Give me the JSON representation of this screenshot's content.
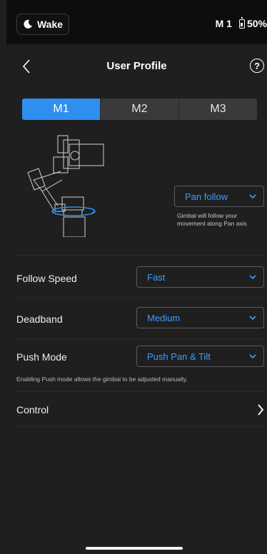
{
  "status_bar": {
    "wake_label": "Wake",
    "mode_label": "M 1",
    "battery_label": "50%"
  },
  "header": {
    "title": "User Profile",
    "help_symbol": "?"
  },
  "tabs": [
    {
      "label": "M1",
      "active": true
    },
    {
      "label": "M2",
      "active": false
    },
    {
      "label": "M3",
      "active": false
    }
  ],
  "pan_mode": {
    "value": "Pan follow",
    "description": "Gimbal will follow your movement along Pan axis"
  },
  "settings": {
    "follow_speed": {
      "label": "Follow Speed",
      "value": "Fast"
    },
    "deadband": {
      "label": "Deadband",
      "value": "Medium"
    },
    "push_mode": {
      "label": "Push Mode",
      "value": "Push Pan & Tilt",
      "note": "Enabling Push mode allows the gimbal to be adjusted manually."
    }
  },
  "control": {
    "label": "Control"
  },
  "colors": {
    "accent": "#2f8ff0",
    "accent_text": "#3b9cff",
    "background": "#1f1f1f",
    "topbar": "#0d0d0d"
  },
  "icons": [
    "moon-icon",
    "battery-icon",
    "back-chevron-icon",
    "help-icon",
    "chevron-down-icon",
    "chevron-right-icon",
    "gimbal-illustration"
  ]
}
